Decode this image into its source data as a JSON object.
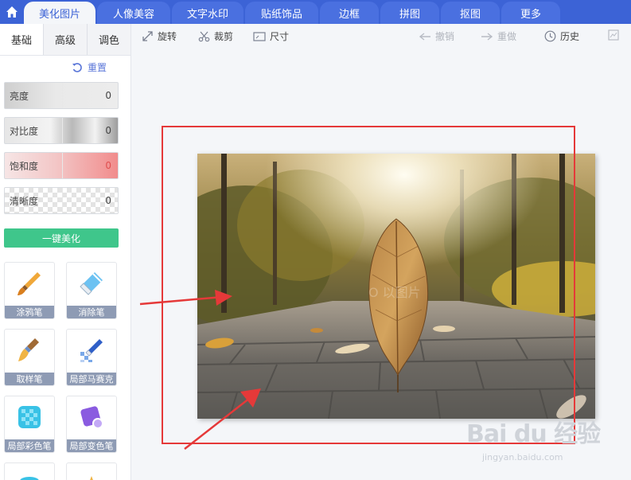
{
  "nav": {
    "tabs": [
      "美化图片",
      "人像美容",
      "文字水印",
      "贴纸饰品",
      "边框",
      "拼图",
      "抠图",
      "更多"
    ],
    "active_index": 0
  },
  "sidebar": {
    "subtabs": [
      "基础",
      "高级",
      "调色"
    ],
    "reset_label": "重置",
    "sliders": [
      {
        "label": "亮度",
        "value": "0"
      },
      {
        "label": "对比度",
        "value": "0"
      },
      {
        "label": "饱和度",
        "value": "0"
      },
      {
        "label": "清晰度",
        "value": "0"
      }
    ],
    "onekey_label": "一键美化",
    "tools": [
      {
        "name": "涂鸦笔",
        "icon": "brush-icon"
      },
      {
        "name": "消除笔",
        "icon": "eraser-icon"
      },
      {
        "name": "取样笔",
        "icon": "sample-brush-icon"
      },
      {
        "name": "局部马赛克",
        "icon": "mosaic-pen-icon"
      },
      {
        "name": "局部彩色笔",
        "icon": "color-pen-icon"
      },
      {
        "name": "局部变色笔",
        "icon": "recolor-pen-icon"
      }
    ]
  },
  "toolbar": {
    "rotate": "旋转",
    "crop": "裁剪",
    "size": "尺寸",
    "undo": "撤销",
    "redo": "重做",
    "history": "历史"
  },
  "watermark": {
    "main": "Bai du 经验",
    "sub": "jingyan.baidu.com"
  },
  "colors": {
    "nav_bg": "#3c63d6",
    "accent_green": "#3fc68b",
    "annotation_red": "#e53939"
  }
}
